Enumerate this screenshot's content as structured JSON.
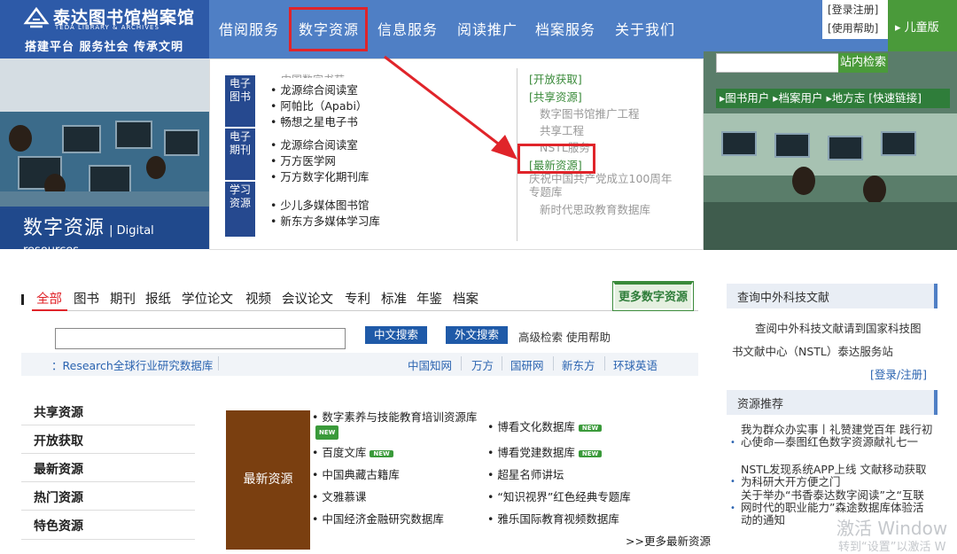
{
  "header": {
    "logo_cn": "泰达图书馆档案馆",
    "logo_en": "TEDA LIBRARY & ARCHIVES",
    "slogan": "搭建平台 服务社会 传承文明",
    "nav": [
      "借阅服务",
      "数字资源",
      "信息服务",
      "阅读推广",
      "档案服务",
      "关于我们"
    ],
    "util_login": "[登录注册]",
    "util_help": "[使用帮助]",
    "kids": "儿童版"
  },
  "banner": {
    "title": "数字资源",
    "subtitle": "| Digital resources"
  },
  "dropdown": {
    "cat_ebook": "电子图书",
    "cat_journal": "电子期刊",
    "cat_study": "学习资源",
    "ebook_items": [
      "龙源综合阅读室",
      "阿帕比（Apabi）",
      "畅想之星电子书"
    ],
    "journal_items": [
      "龙源综合阅读室",
      "万方医学网",
      "万方数字化期刊库"
    ],
    "study_items": [
      "少儿多媒体图书馆",
      "新东方多媒体学习库"
    ],
    "open_access": "[开放获取]",
    "shared": "[共享资源]",
    "shared_items": [
      "数字图书馆推广工程",
      "共享工程",
      "NSTL服务"
    ],
    "latest": "[最新资源]",
    "latest_items": [
      "庆祝中国共产党成立100周年专题库",
      "新时代思政教育数据库"
    ]
  },
  "topright": {
    "search_button": "站内检索",
    "links": "▸图书用户 ▸档案用户 ▸地方志  [快速链接]"
  },
  "tabs": [
    "全部",
    "图书",
    "期刊",
    "报纸",
    "学位论文",
    "视频",
    "会议论文",
    "专利",
    "标准",
    "年鉴",
    "档案"
  ],
  "more_digital": "更多数字资源",
  "search": {
    "button_cn": "中文搜索",
    "button_foreign": "外文搜索",
    "advanced": "高级检索 使用帮助"
  },
  "quicklinks": {
    "research": "：Research全球行业研究数据库",
    "items": [
      "中国知网",
      "万方",
      "国研网",
      "新东方",
      "环球英语"
    ]
  },
  "sidebar": [
    "共享资源",
    "开放获取",
    "最新资源",
    "热门资源",
    "特色资源"
  ],
  "latest_resources": {
    "label": "最新资源",
    "left": [
      "数字素养与技能教育培训资源库",
      "百度文库",
      "中国典藏古籍库",
      "文雅慕课",
      "中国经济金融研究数据库"
    ],
    "right": [
      "博看文化数据库",
      "博看党建数据库",
      "超星名师讲坛",
      "“知识视界”红色经典专题库",
      "雅乐国际教育视频数据库"
    ],
    "new_badge": "NEW",
    "more": ">>更多最新资源"
  },
  "right_col": {
    "nstl_head": "查询中外科技文献",
    "nstl_line1": "查阅中外科技文献请到国家科技图",
    "nstl_line2": "书文献中心（NSTL）泰达服务站",
    "register": "[登录/注册]",
    "rec_head": "资源推荐",
    "rec_items": [
      "我为群众办实事丨礼赞建党百年 践行初心使命—泰图红色数字资源献礼七一",
      "NSTL发现系统APP上线 文献移动获取为科研大开方便之门",
      "关于举办“书香泰达数字阅读”之“互联网时代的职业能力”森途数据库体验活动的通知"
    ]
  },
  "watermark": {
    "line1": "激活 Window",
    "line2": "转到“设置”以激活 W"
  }
}
